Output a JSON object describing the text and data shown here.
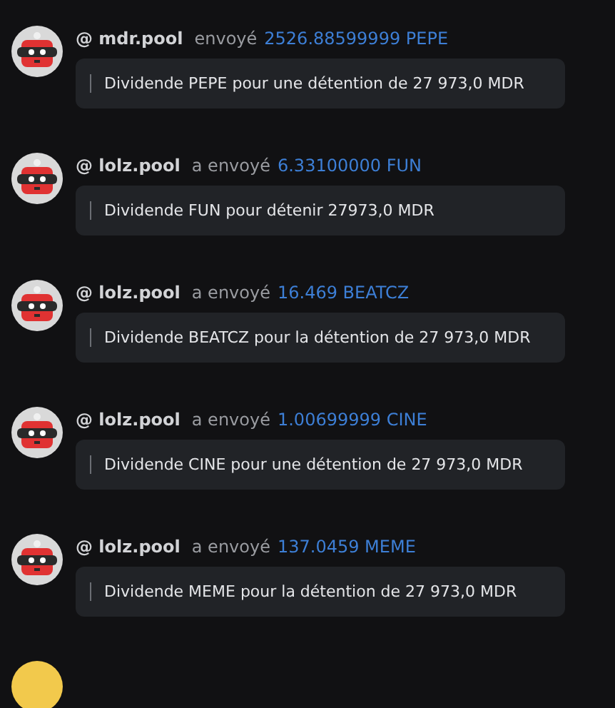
{
  "messages": [
    {
      "author": "@ mdr.pool",
      "verb": "envoyé",
      "amount": "2526.88599999 PEPE",
      "note": "Dividende PEPE pour une détention de 27 973,0 MDR"
    },
    {
      "author": "@ lolz.pool",
      "verb": "a envoyé",
      "amount": "6.33100000 FUN",
      "note": "Dividende FUN pour détenir 27973,0 MDR"
    },
    {
      "author": "@ lolz.pool",
      "verb": "a envoyé",
      "amount": "16.469 BEATCZ",
      "note": "Dividende BEATCZ pour la détention de 27 973,0 MDR"
    },
    {
      "author": "@ lolz.pool",
      "verb": "a envoyé",
      "amount": "1.00699999 CINE",
      "note": "Dividende CINE pour une détention de 27 973,0 MDR"
    },
    {
      "author": "@ lolz.pool",
      "verb": "a envoyé",
      "amount": "137.0459 MEME",
      "note": "Dividende MEME pour la détention de 27 973,0 MDR"
    }
  ]
}
